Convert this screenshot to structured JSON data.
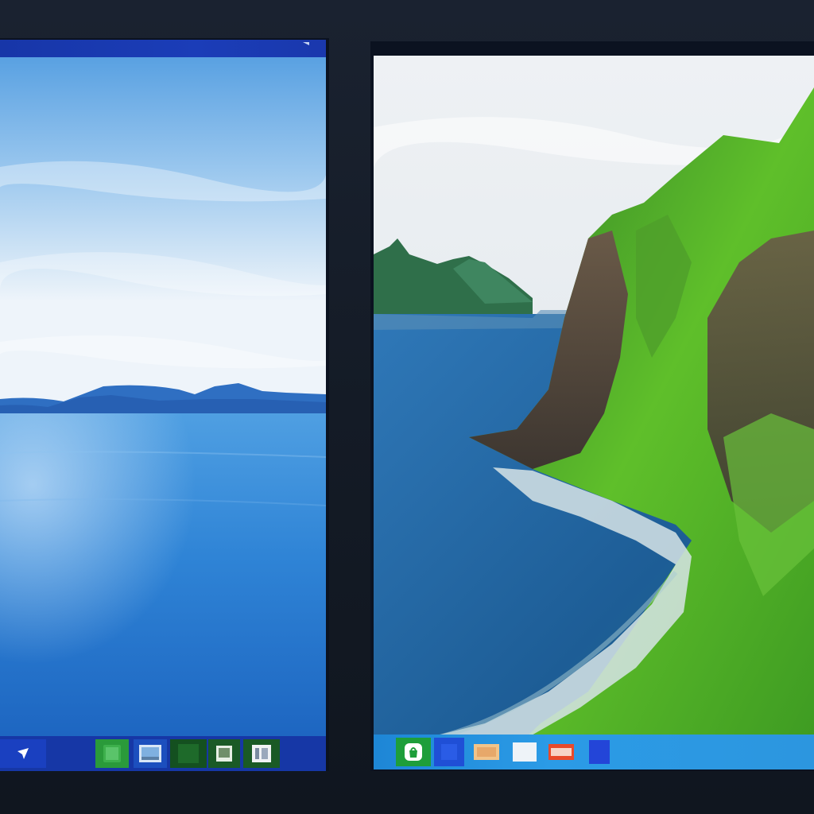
{
  "colors": {
    "desktop_bg": "#141b26",
    "taskbar_left": "#1637a6",
    "taskbar_right": "#2c96df",
    "titlebar": "#1b3db8",
    "accent_green": "#2a9a3a"
  },
  "left_monitor": {
    "wallpaper": "ocean-horizon-wallpaper",
    "taskbar_icons": [
      "start-icon",
      "cursor-icon",
      "app-green-icon",
      "photos-icon",
      "app-dark-icon",
      "gallery-icon",
      "document-icon"
    ]
  },
  "right_monitor": {
    "wallpaper": "green-cliffs-coast-wallpaper",
    "taskbar_icons": [
      "store-icon",
      "app-blue-icon",
      "file-explorer-icon",
      "notes-icon",
      "media-icon",
      "app-square-icon"
    ]
  }
}
